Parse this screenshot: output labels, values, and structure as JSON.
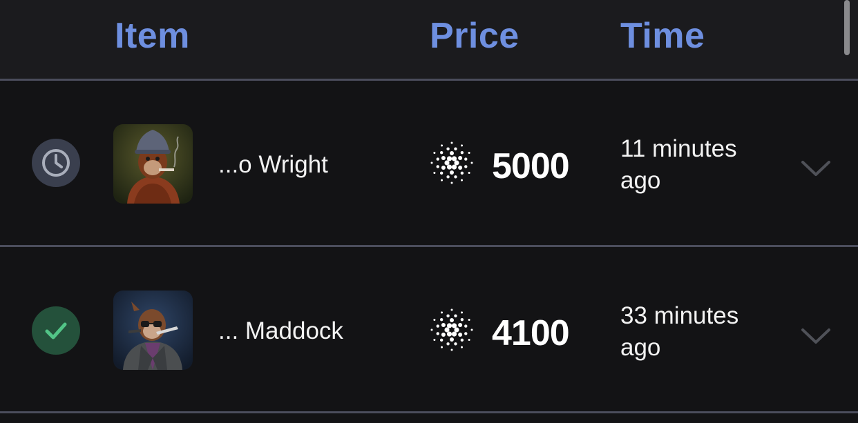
{
  "table": {
    "headers": {
      "item": "Item",
      "price": "Price",
      "time": "Time"
    },
    "rows": [
      {
        "status": "pending",
        "status_icon": "clock-icon",
        "item_name": "...o Wright",
        "currency_icon": "cardano-ada-icon",
        "price": "5000",
        "time": "11 minutes ago"
      },
      {
        "status": "completed",
        "status_icon": "check-icon",
        "item_name": "... Maddock",
        "currency_icon": "cardano-ada-icon",
        "price": "4100",
        "time": "33 minutes ago"
      }
    ]
  },
  "colors": {
    "header_text": "#6e8fe0",
    "divider": "#4b4d5c",
    "pending_badge": "#3a3f4e",
    "completed_badge": "#24513b",
    "check": "#52c487"
  }
}
